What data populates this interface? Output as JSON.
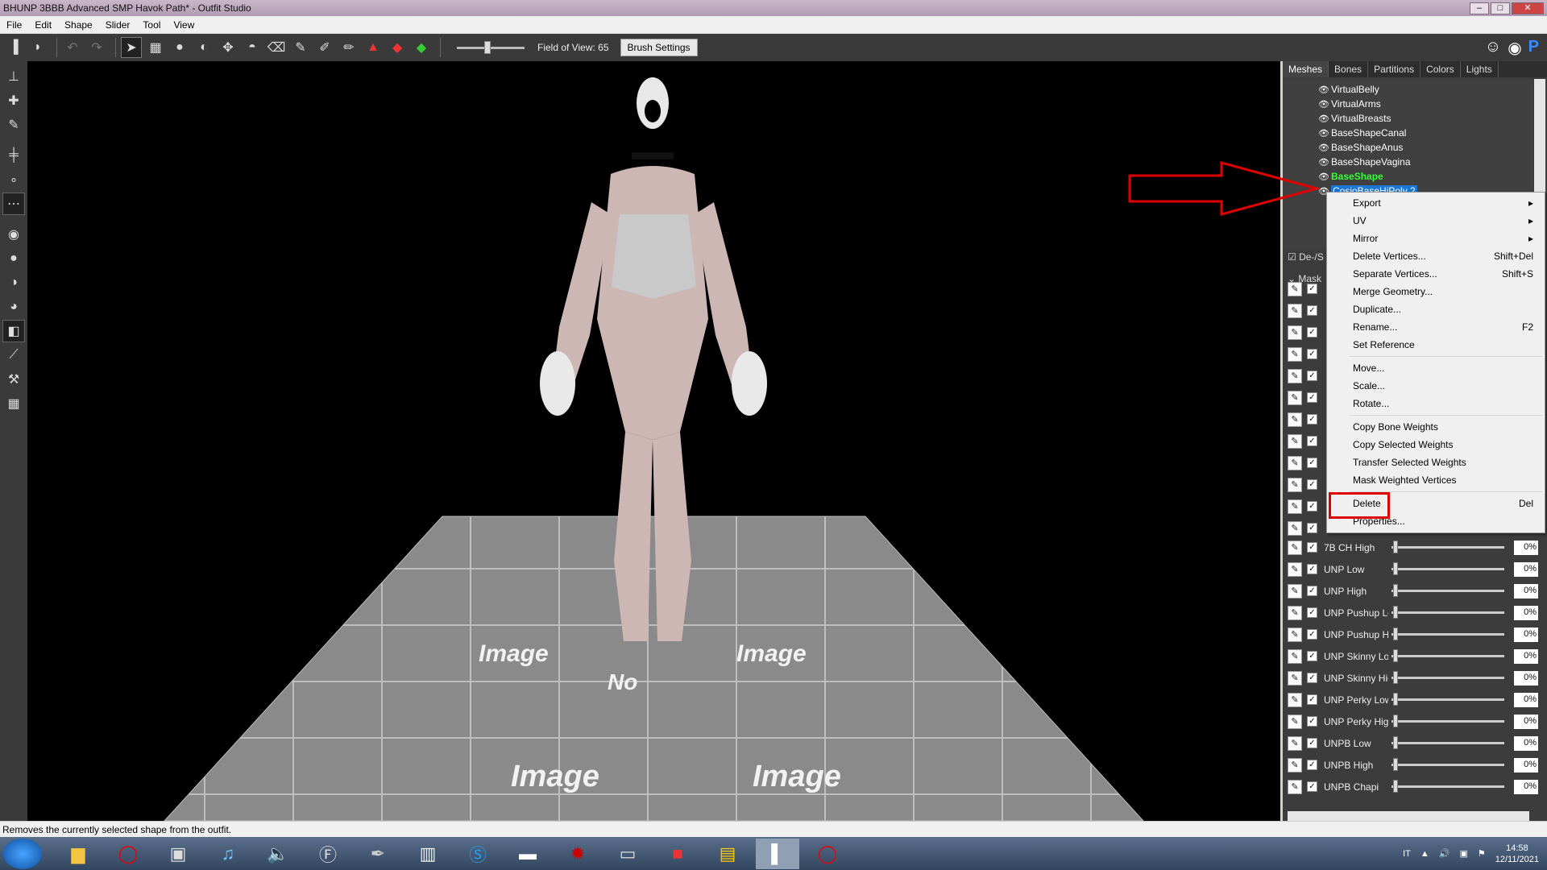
{
  "window": {
    "title": "BHUNP 3BBB Advanced SMP Havok Path* - Outfit Studio"
  },
  "menu": [
    "File",
    "Edit",
    "Shape",
    "Slider",
    "Tool",
    "View"
  ],
  "toolbar": {
    "fov_label": "Field of View: 65",
    "brush_settings": "Brush Settings"
  },
  "panel": {
    "tabs": [
      "Meshes",
      "Bones",
      "Partitions",
      "Colors",
      "Lights"
    ],
    "meshes": [
      "VirtualBelly",
      "VirtualArms",
      "VirtualBreasts",
      "BaseShapeCanal",
      "BaseShapeAnus",
      "BaseShapeVagina",
      "BaseShape",
      "CosioBaseHiPoly 2"
    ],
    "deselect_label": "De-/S",
    "mask_label": "Mask",
    "sliders": [
      {
        "name": "7B CH High",
        "value": "0%"
      },
      {
        "name": "UNP Low",
        "value": "0%"
      },
      {
        "name": "UNP High",
        "value": "0%"
      },
      {
        "name": "UNP Pushup Low",
        "value": "0%"
      },
      {
        "name": "UNP Pushup High",
        "value": "0%"
      },
      {
        "name": "UNP Skinny Low",
        "value": "0%"
      },
      {
        "name": "UNP Skinny High",
        "value": "0%"
      },
      {
        "name": "UNP Perky Low",
        "value": "0%"
      },
      {
        "name": "UNP Perky High",
        "value": "0%"
      },
      {
        "name": "UNPB Low",
        "value": "0%"
      },
      {
        "name": "UNPB High",
        "value": "0%"
      },
      {
        "name": "UNPB Chapi",
        "value": "0%"
      }
    ]
  },
  "context_menu": {
    "export": "Export",
    "uv": "UV",
    "mirror": "Mirror",
    "delete_vertices": "Delete Vertices...",
    "delete_vertices_key": "Shift+Del",
    "separate_vertices": "Separate Vertices...",
    "separate_vertices_key": "Shift+S",
    "merge_geometry": "Merge Geometry...",
    "duplicate": "Duplicate...",
    "rename": "Rename...",
    "rename_key": "F2",
    "set_reference": "Set Reference",
    "move": "Move...",
    "scale": "Scale...",
    "rotate": "Rotate...",
    "copy_bone_weights": "Copy Bone Weights",
    "copy_selected_weights": "Copy Selected Weights",
    "transfer_selected_weights": "Transfer Selected Weights",
    "mask_weighted_vertices": "Mask Weighted Vertices",
    "delete": "Delete",
    "delete_key": "Del",
    "properties": "Properties..."
  },
  "viewport": {
    "floor_tile_text_1": "Image",
    "floor_tile_text_2": "No"
  },
  "status": "Removes the currently selected shape from the outfit.",
  "taskbar": {
    "lang": "IT",
    "time": "14:58",
    "date": "12/11/2021"
  },
  "colors": {
    "selection": "#1976d2",
    "base_shape": "#33ff33",
    "annotation_red": "#e10000"
  }
}
